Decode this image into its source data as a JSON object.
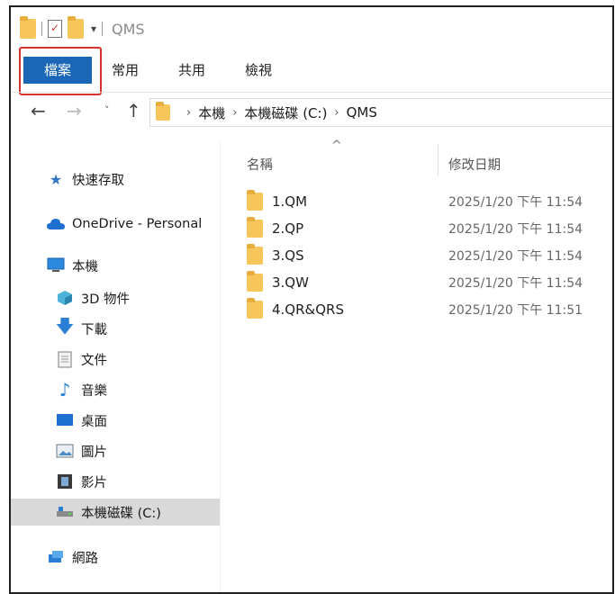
{
  "window": {
    "title": "QMS"
  },
  "ribbon": {
    "tabs": [
      "檔案",
      "常用",
      "共用",
      "檢視"
    ]
  },
  "address": {
    "crumbs": [
      "本機",
      "本機磁碟 (C:)",
      "QMS"
    ]
  },
  "columns": {
    "name": "名稱",
    "date": "修改日期",
    "sort_indicator": "^"
  },
  "sidebar": {
    "items": [
      {
        "label": "快速存取",
        "icon": "star-icon"
      },
      {
        "label": "OneDrive - Personal",
        "icon": "cloud-icon"
      },
      {
        "label": "本機",
        "icon": "computer-icon"
      },
      {
        "label": "3D 物件",
        "icon": "cube-icon"
      },
      {
        "label": "下載",
        "icon": "download-arrow-icon"
      },
      {
        "label": "文件",
        "icon": "document-icon"
      },
      {
        "label": "音樂",
        "icon": "music-note-icon"
      },
      {
        "label": "桌面",
        "icon": "desktop-icon"
      },
      {
        "label": "圖片",
        "icon": "picture-icon"
      },
      {
        "label": "影片",
        "icon": "film-icon"
      },
      {
        "label": "本機磁碟 (C:)",
        "icon": "drive-icon",
        "selected": true
      },
      {
        "label": "網路",
        "icon": "network-icon"
      }
    ]
  },
  "files": [
    {
      "name": "1.QM",
      "date": "2025/1/20 下午 11:54"
    },
    {
      "name": "2.QP",
      "date": "2025/1/20 下午 11:54"
    },
    {
      "name": "3.QS",
      "date": "2025/1/20 下午 11:54"
    },
    {
      "name": "3.QW",
      "date": "2025/1/20 下午 11:54"
    },
    {
      "name": "4.QR&QRS",
      "date": "2025/1/20 下午 11:51"
    }
  ],
  "colors": {
    "file_tab": "#1a67b8",
    "highlight": "#d93030",
    "folder": "#f7c65a"
  }
}
